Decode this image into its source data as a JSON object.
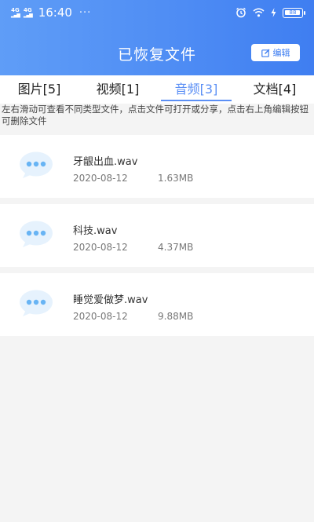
{
  "status": {
    "sim1": "4G",
    "sim2": "4G",
    "time": "16:40",
    "dots": "···",
    "battery": "88"
  },
  "header": {
    "title": "已恢复文件",
    "edit_label": "编辑"
  },
  "tabs": [
    {
      "label": "图片[5]"
    },
    {
      "label": "视频[1]"
    },
    {
      "label": "音频[3]"
    },
    {
      "label": "文档[4]"
    }
  ],
  "active_tab": "音频[3]",
  "hint": "左右滑动可查看不同类型文件，点击文件可打开或分享，点击右上角编辑按钮可删除文件",
  "files": [
    {
      "name": "牙龈出血.wav",
      "date": "2020-08-12",
      "size": "1.63MB"
    },
    {
      "name": "科技.wav",
      "date": "2020-08-12",
      "size": "4.37MB"
    },
    {
      "name": "睡觉爱做梦.wav",
      "date": "2020-08-12",
      "size": "9.88MB"
    }
  ],
  "colors": {
    "accent": "#5b8ff5",
    "header_start": "#5f9df7",
    "header_end": "#3f7ef1",
    "bubble": "#e6f2fd",
    "bubble_dots": "#68b4f4"
  }
}
